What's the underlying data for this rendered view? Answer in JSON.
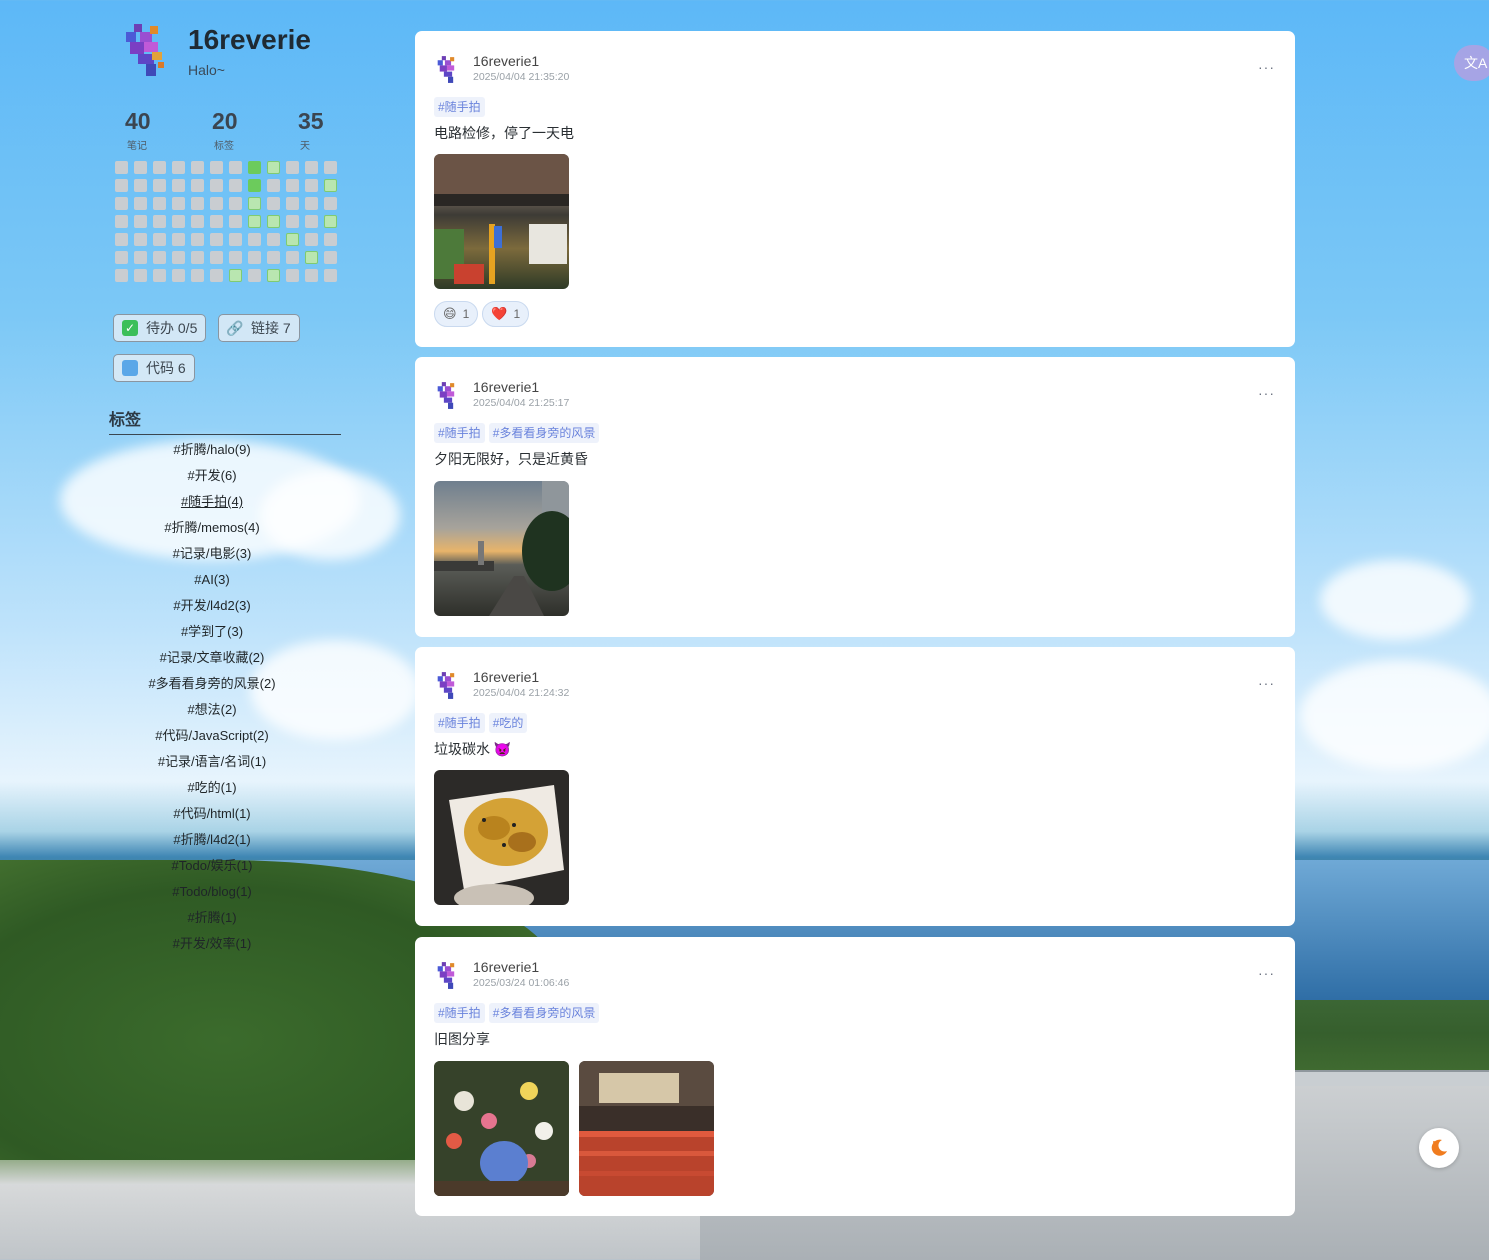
{
  "profile": {
    "name": "16reverie",
    "motto": "Halo~"
  },
  "stats": [
    {
      "value": "40",
      "label": "笔记"
    },
    {
      "value": "20",
      "label": "标签"
    },
    {
      "value": "35",
      "label": "天"
    }
  ],
  "heatmap": {
    "levels": [
      [
        0,
        0,
        0,
        0,
        0,
        0,
        0,
        2,
        1,
        0,
        0,
        0
      ],
      [
        0,
        0,
        0,
        0,
        0,
        0,
        0,
        2,
        0,
        0,
        0,
        1
      ],
      [
        0,
        0,
        0,
        0,
        0,
        0,
        0,
        1,
        0,
        0,
        0,
        0
      ],
      [
        0,
        0,
        0,
        0,
        0,
        0,
        0,
        1,
        1,
        0,
        0,
        1
      ],
      [
        0,
        0,
        0,
        0,
        0,
        0,
        0,
        0,
        0,
        1,
        0,
        0
      ],
      [
        0,
        0,
        0,
        0,
        0,
        0,
        0,
        0,
        0,
        0,
        1,
        0
      ],
      [
        0,
        0,
        0,
        0,
        0,
        0,
        1,
        0,
        1,
        0,
        0,
        0
      ]
    ]
  },
  "shortcuts": {
    "todo": "待办 0/5",
    "links": "链接 7",
    "code": "代码 6"
  },
  "tags_title": "标签",
  "tags": [
    "#折腾/halo(9)",
    "#开发(6)",
    "#随手拍(4)",
    "#折腾/memos(4)",
    "#记录/电影(3)",
    "#AI(3)",
    "#开发/l4d2(3)",
    "#学到了(3)",
    "#记录/文章收藏(2)",
    "#多看看身旁的风景(2)",
    "#想法(2)",
    "#代码/JavaScript(2)",
    "#记录/语言/名词(1)",
    "#吃的(1)",
    "#代码/html(1)",
    "#折腾/l4d2(1)",
    "#Todo/娱乐(1)",
    "#Todo/blog(1)",
    "#折腾(1)",
    "#开发/效率(1)"
  ],
  "posts": [
    {
      "author": "16reverie1",
      "time": "2025/04/04 21:35:20",
      "tags": [
        "#随手拍"
      ],
      "content": "电路检修，停了一天电",
      "photos": [
        "repair-photo"
      ],
      "reactions": [
        {
          "emoji": "😄",
          "count": "1"
        },
        {
          "emoji": "❤️",
          "count": "1"
        }
      ]
    },
    {
      "author": "16reverie1",
      "time": "2025/04/04 21:25:17",
      "tags": [
        "#随手拍",
        "#多看看身旁的风景"
      ],
      "content": "夕阳无限好，只是近黄昏",
      "photos": [
        "sunset-photo"
      ]
    },
    {
      "author": "16reverie1",
      "time": "2025/04/04 21:24:32",
      "tags": [
        "#随手拍",
        "#吃的"
      ],
      "content": "垃圾碳水 👿",
      "photos": [
        "food-photo"
      ]
    },
    {
      "author": "16reverie1",
      "time": "2025/03/24 01:06:46",
      "tags": [
        "#随手拍",
        "#多看看身旁的风景"
      ],
      "content": "旧图分享",
      "photos": [
        "flowers-photo",
        "wishes-photo"
      ]
    }
  ],
  "more_label": "···",
  "translate_label": "文A",
  "colors": {
    "tag_text": "#6a83dc",
    "tag_bg": "#eef2fb",
    "heat_high": "#6ccb5c",
    "heat_low": "#b9e6b0"
  }
}
